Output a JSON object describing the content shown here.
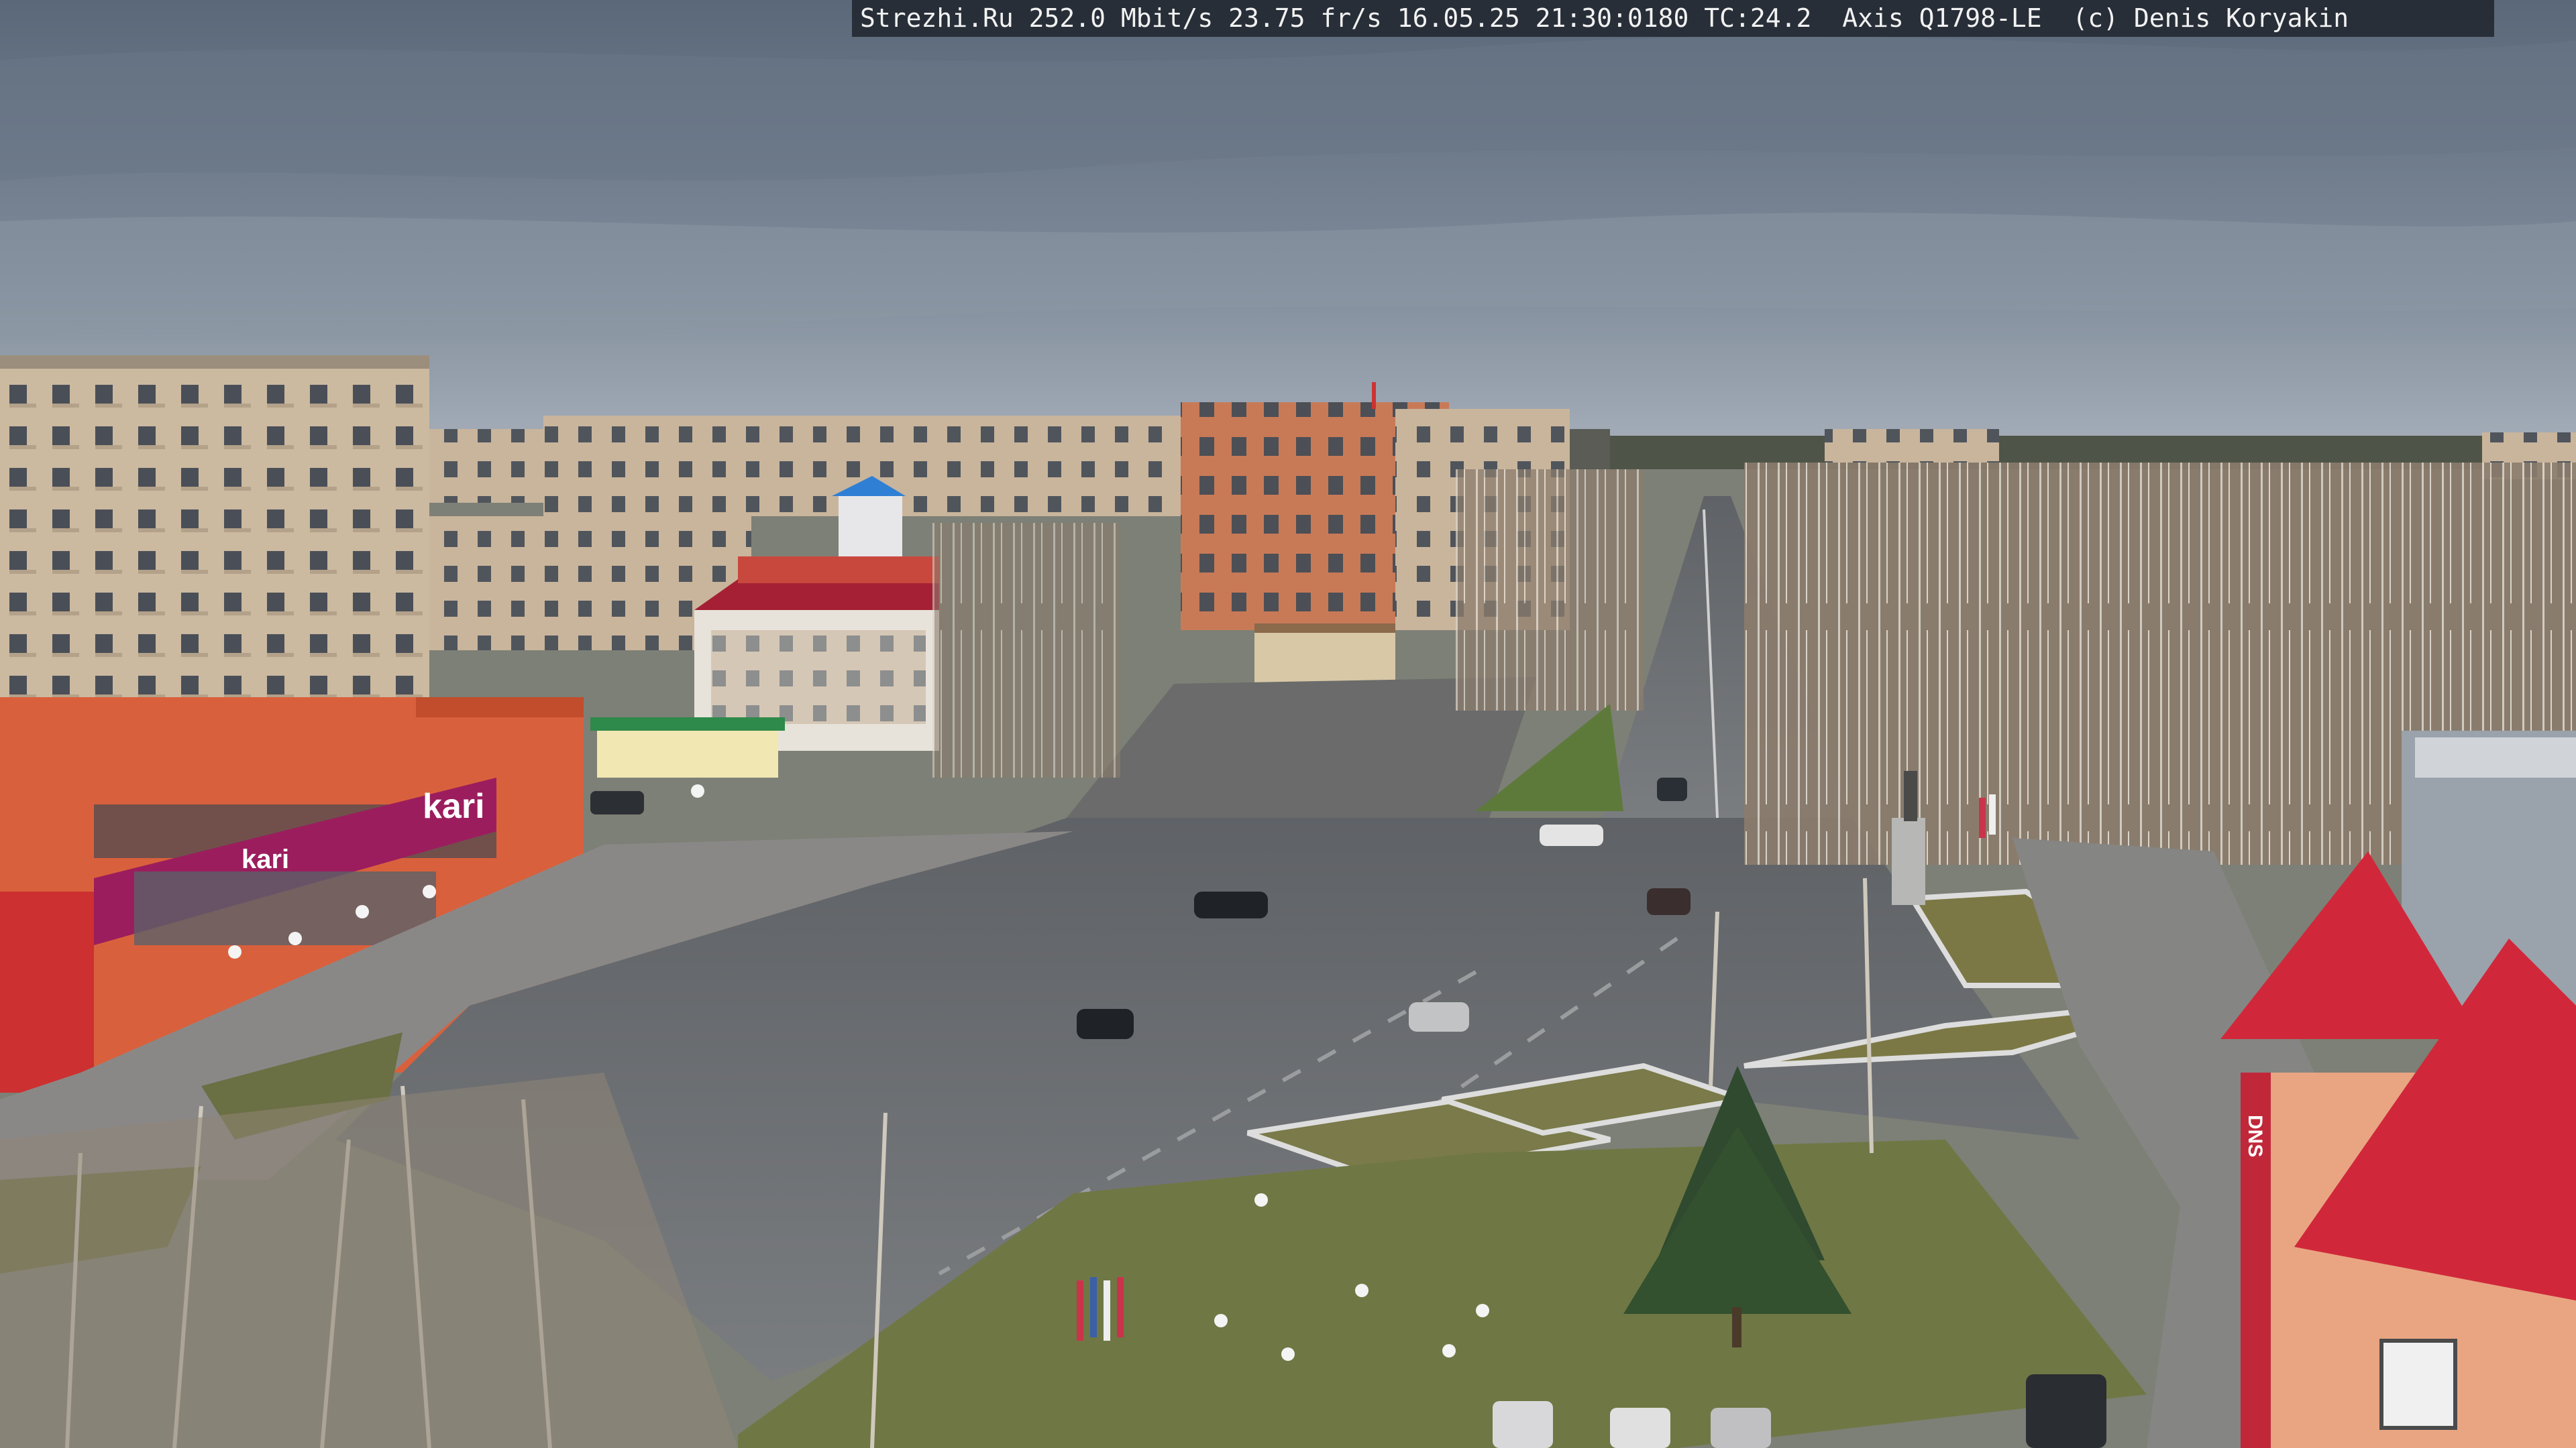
{
  "overlay": {
    "text": "Strezhi.Ru 252.0 Mbit/s 23.75 fr/s 16.05.25 21:30:0180 TC:24.2  Axis Q1798-LE  (c) Denis Koryakin"
  },
  "signs": {
    "store_big": "kari",
    "store_small": "kari",
    "dns": "DNS"
  },
  "colors": {
    "sky_top": "#5d6b7c",
    "sky_bottom": "#a3adb8",
    "asphalt": "#6e7174",
    "grass": "#6e7540",
    "kari_magenta": "#9b1d5e",
    "roof_red": "#d0283a",
    "facade_orange": "#d9603c"
  }
}
